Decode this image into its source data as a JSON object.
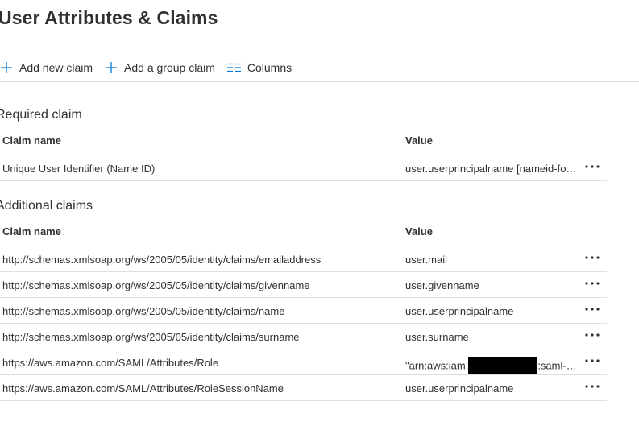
{
  "page": {
    "title": "User Attributes & Claims"
  },
  "toolbar": {
    "add_new_claim": "Add new claim",
    "add_group_claim": "Add a group claim",
    "columns": "Columns"
  },
  "required": {
    "section_title": "Required claim",
    "header_name": "Claim name",
    "header_value": "Value",
    "rows": [
      {
        "name": "Unique User Identifier (Name ID)",
        "value": "user.userprincipalname [nameid-format:emailAddress]"
      }
    ]
  },
  "additional": {
    "section_title": "Additional claims",
    "header_name": "Claim name",
    "header_value": "Value",
    "rows": [
      {
        "name": "http://schemas.xmlsoap.org/ws/2005/05/identity/claims/emailaddress",
        "value": "user.mail"
      },
      {
        "name": "http://schemas.xmlsoap.org/ws/2005/05/identity/claims/givenname",
        "value": "user.givenname"
      },
      {
        "name": "http://schemas.xmlsoap.org/ws/2005/05/identity/claims/name",
        "value": "user.userprincipalname"
      },
      {
        "name": "http://schemas.xmlsoap.org/ws/2005/05/identity/claims/surname",
        "value": "user.surname"
      },
      {
        "name": "https://aws.amazon.com/SAML/Attributes/Role",
        "value_prefix": "\"arn:aws:iam:",
        "value_suffix": ":saml-provider"
      },
      {
        "name": "https://aws.amazon.com/SAML/Attributes/RoleSessionName",
        "value": "user.userprincipalname"
      }
    ]
  },
  "colors": {
    "accent": "#0078d4",
    "text": "#323130",
    "divider": "#e1dfdd",
    "redaction": "#000000"
  },
  "icons": {
    "add_new_claim": "plus-icon",
    "add_group_claim": "plus-icon",
    "columns": "columns-icon",
    "row_actions": "more-horizontal-icon"
  }
}
